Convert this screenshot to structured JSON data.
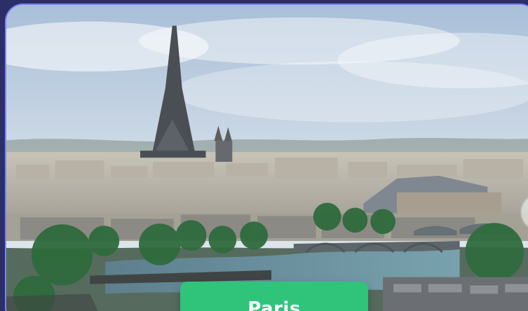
{
  "card": {
    "city_label": "Paris"
  },
  "colors": {
    "background": "#2b2f66",
    "card_border": "#7b82ff",
    "label_background": "#2fc47a",
    "label_text": "#ffffff"
  },
  "image": {
    "subject": "paris-skyline-photo"
  }
}
